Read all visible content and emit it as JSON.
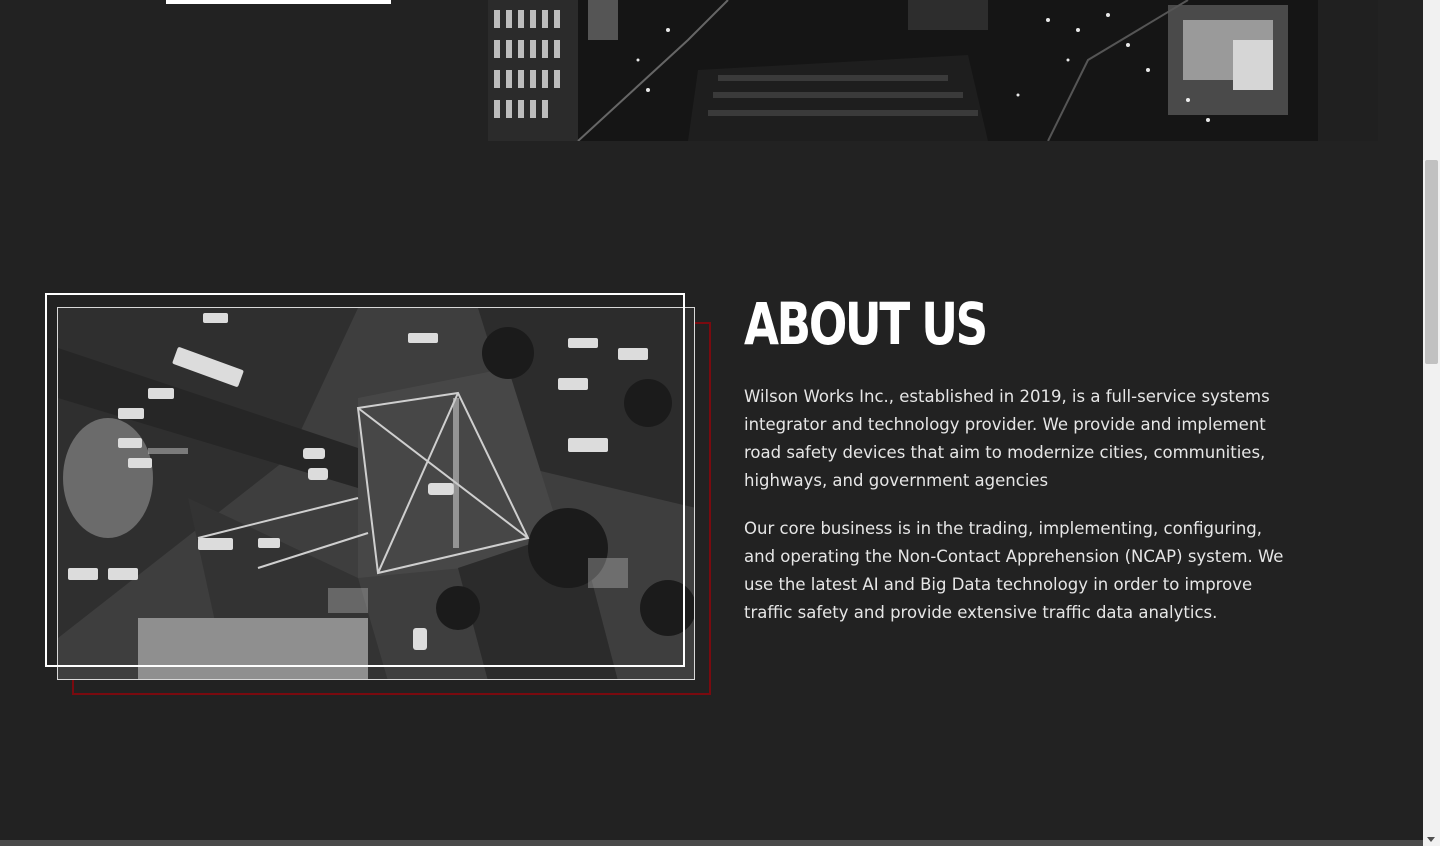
{
  "about": {
    "title": "ABOUT US",
    "paragraph_1": "Wilson Works Inc., established in 2019, is a full-service systems integrator and technology provider. We provide and implement road safety devices that aim to modernize cities, communities, highways, and government agencies",
    "paragraph_2": "Our core business is in the trading, implementing, configuring, and operating the Non-Contact Apprehension (NCAP) system. We use the latest AI and Big Data technology in order to improve traffic safety and provide extensive traffic data analytics."
  },
  "colors": {
    "background": "#222222",
    "text": "#ffffff",
    "accent_frame": "#7a0a0f"
  },
  "icons": {
    "scroll_down": "chevron-down-icon"
  }
}
